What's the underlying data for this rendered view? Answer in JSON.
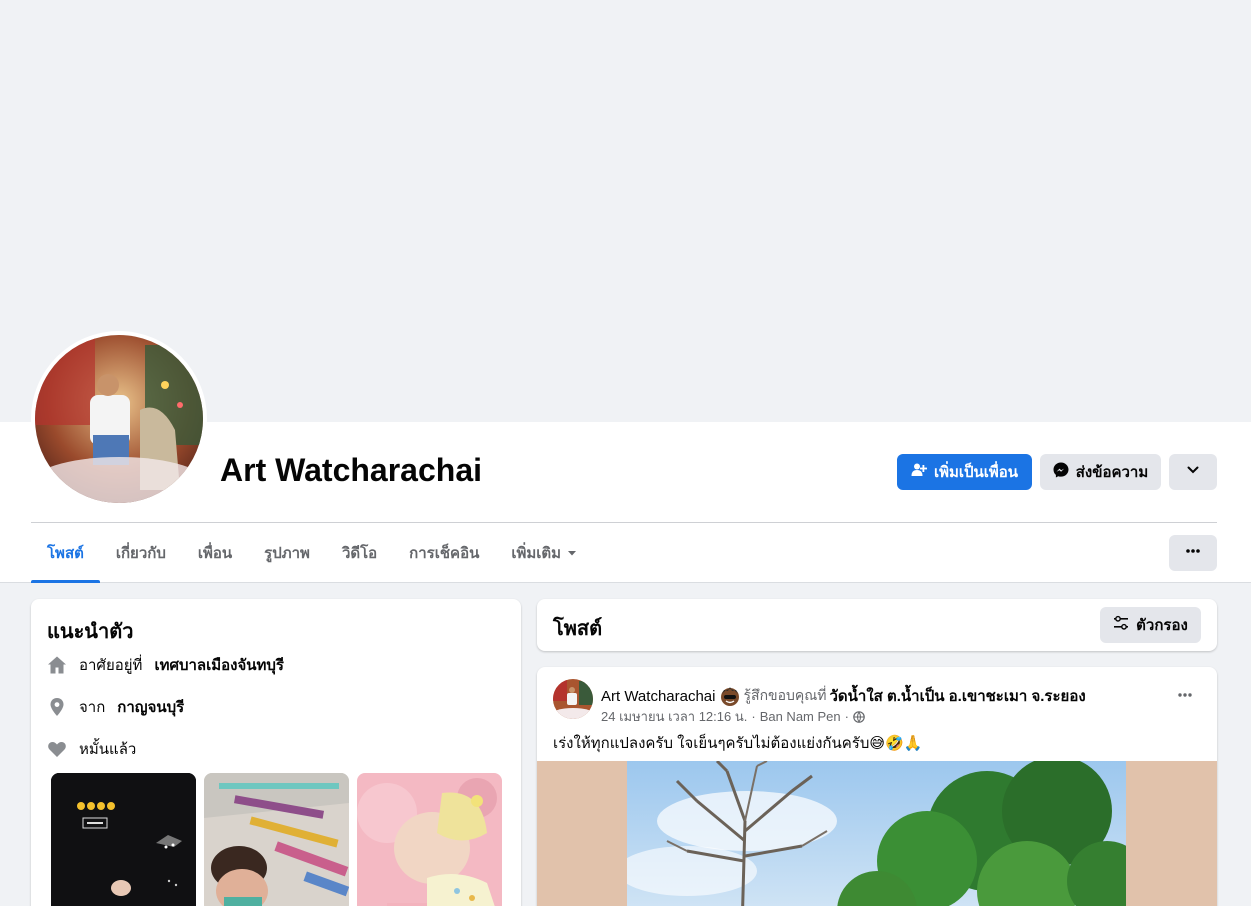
{
  "profile": {
    "name": "Art Watcharachai"
  },
  "actions": {
    "add_friend": "เพิ่มเป็นเพื่อน",
    "message": "ส่งข้อความ"
  },
  "tabs": [
    {
      "label": "โพสต์"
    },
    {
      "label": "เกี่ยวกับ"
    },
    {
      "label": "เพื่อน"
    },
    {
      "label": "รูปภาพ"
    },
    {
      "label": "วิดีโอ"
    },
    {
      "label": "การเช็คอิน"
    },
    {
      "label": "เพิ่มเติม"
    }
  ],
  "intro": {
    "title": "แนะนำตัว",
    "lives_prefix": "อาศัยอยู่ที่",
    "lives_value": "เทศบาลเมืองจันทบุรี",
    "from_prefix": "จาก",
    "from_value": "กาญจนบุรี",
    "relationship": "หมั้นแล้ว"
  },
  "posts_section": {
    "title": "โพสต์",
    "filter_label": "ตัวกรอง"
  },
  "post": {
    "author": "Art Watcharachai",
    "feeling": "รู้สึกขอบคุณที่",
    "place": "วัดน้ำใส ต.น้ำเป็น อ.เขาชะเมา จ.ระยอง",
    "date": "24 เมษายน เวลา 12:16 น.",
    "location": "Ban Nam Pen",
    "sep": "·",
    "text": "เร่งให้ทุกแปลงครับ ใจเย็นๆครับไม่ต้องแย่งกันครับ😅🤣🙏"
  },
  "icons": {
    "add_friend": "person-plus-icon",
    "messenger": "messenger-icon",
    "chevron": "chevron-down-icon",
    "more": "more-dots-icon",
    "filter": "filter-icon",
    "home": "home-icon",
    "pin": "location-pin-icon",
    "heart": "heart-icon",
    "globe": "globe-icon"
  },
  "colors": {
    "accent": "#1b74e4",
    "button_gray": "#e4e6eb",
    "page_bg": "#f0f2f5",
    "secondary_text": "#65676b"
  }
}
